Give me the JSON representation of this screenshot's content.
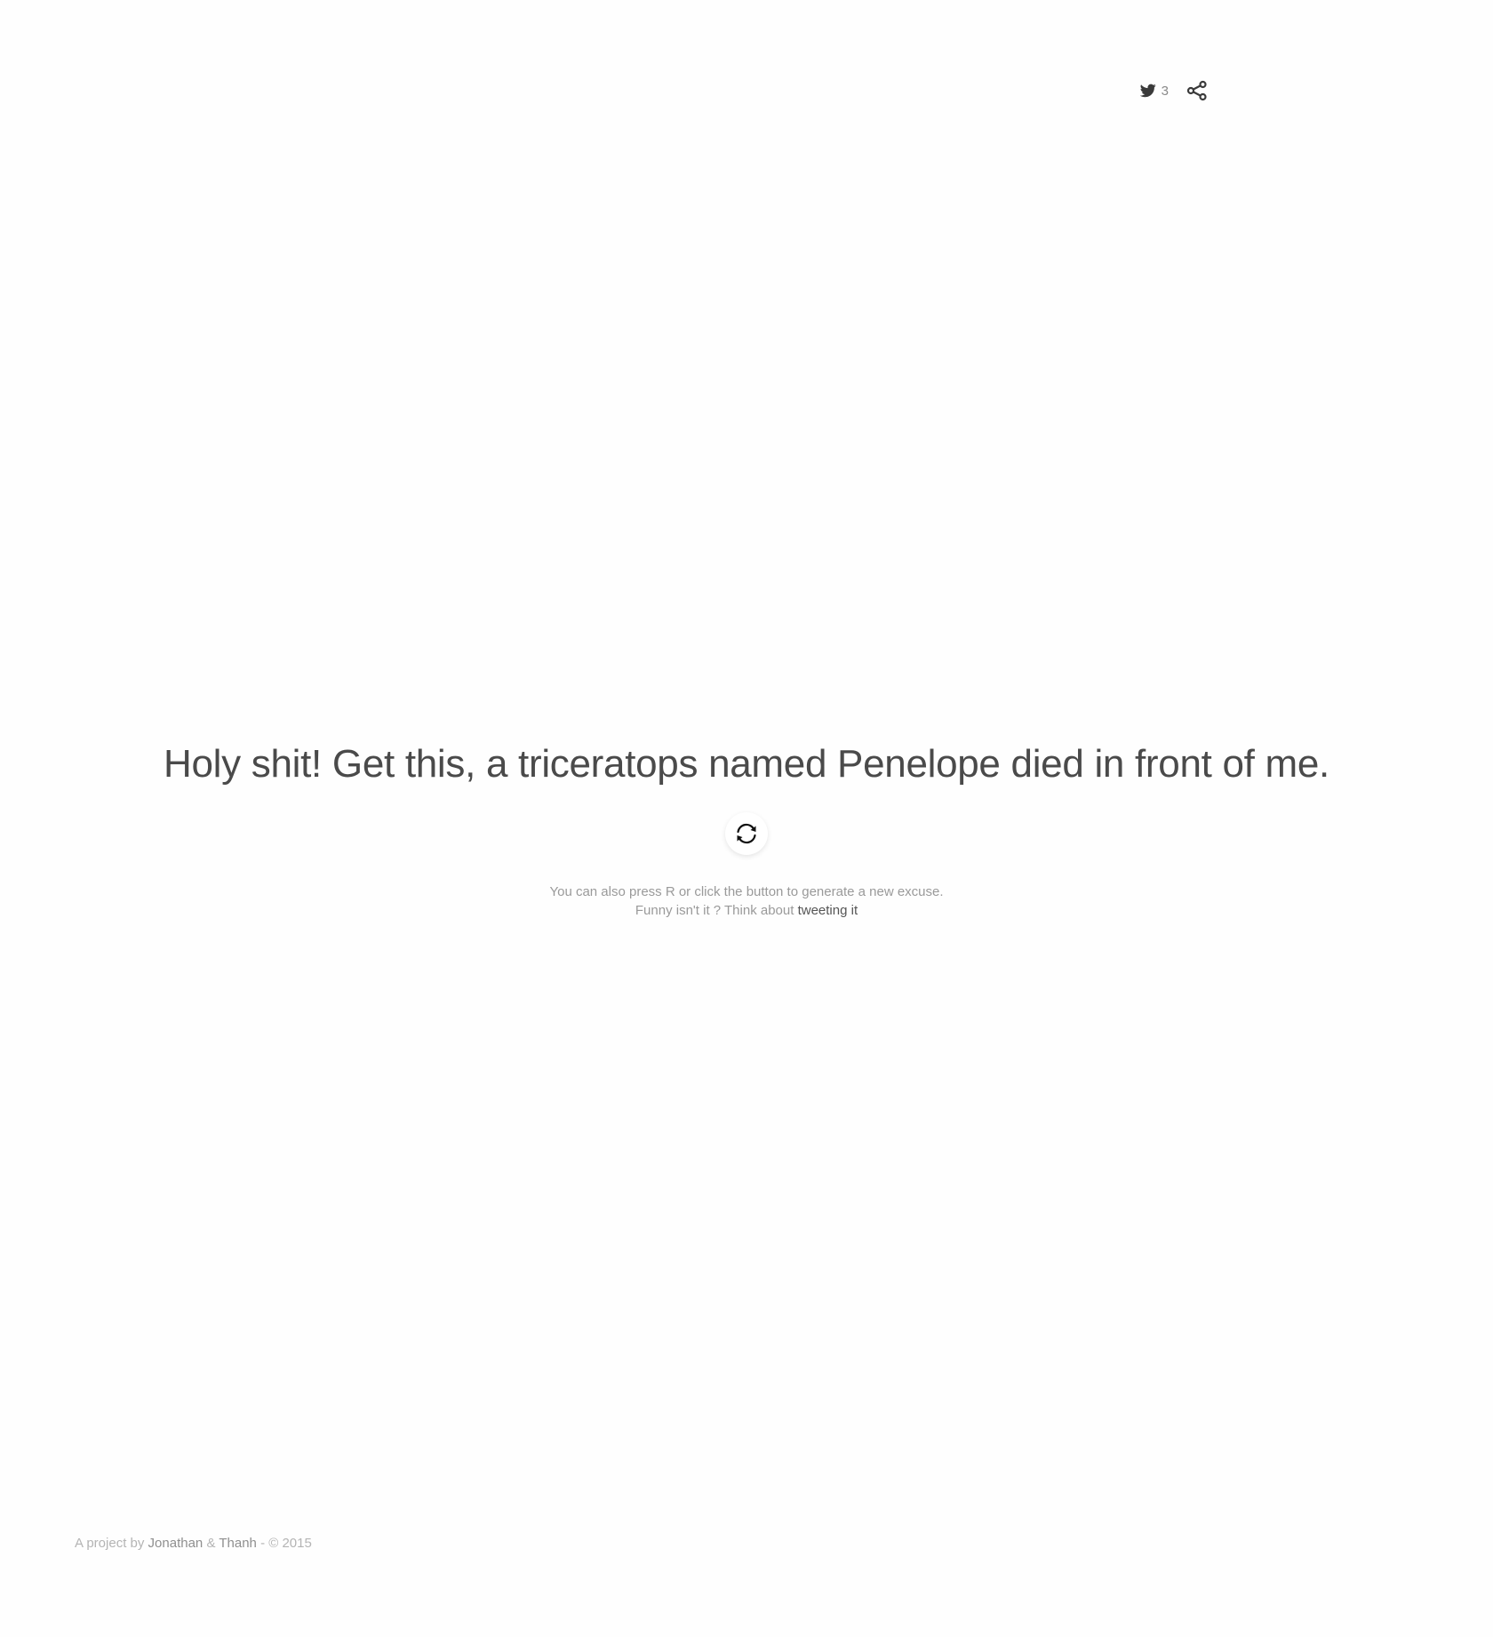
{
  "share": {
    "tweet_count": "3",
    "tweet_icon": "twitter-bird-icon",
    "share_icon": "share-nodes-icon"
  },
  "excuse": {
    "text": "Holy shit! Get this, a triceratops named Penelope died in front of me."
  },
  "refresh": {
    "icon": "refresh-arrows-icon"
  },
  "hints": {
    "line1": "You can also press R or click the button to generate a new excuse.",
    "line2_prefix": "Funny isn't it ? Think about ",
    "tweet_link": "tweeting it"
  },
  "footer": {
    "prefix": "A project by ",
    "author1": "Jonathan",
    "separator": " & ",
    "author2": "Thanh",
    "suffix": " - © 2015"
  },
  "colors": {
    "background": "#fefefe",
    "text_main": "#4a4a4a",
    "text_muted": "#9a9a9a",
    "link": "#555555"
  }
}
